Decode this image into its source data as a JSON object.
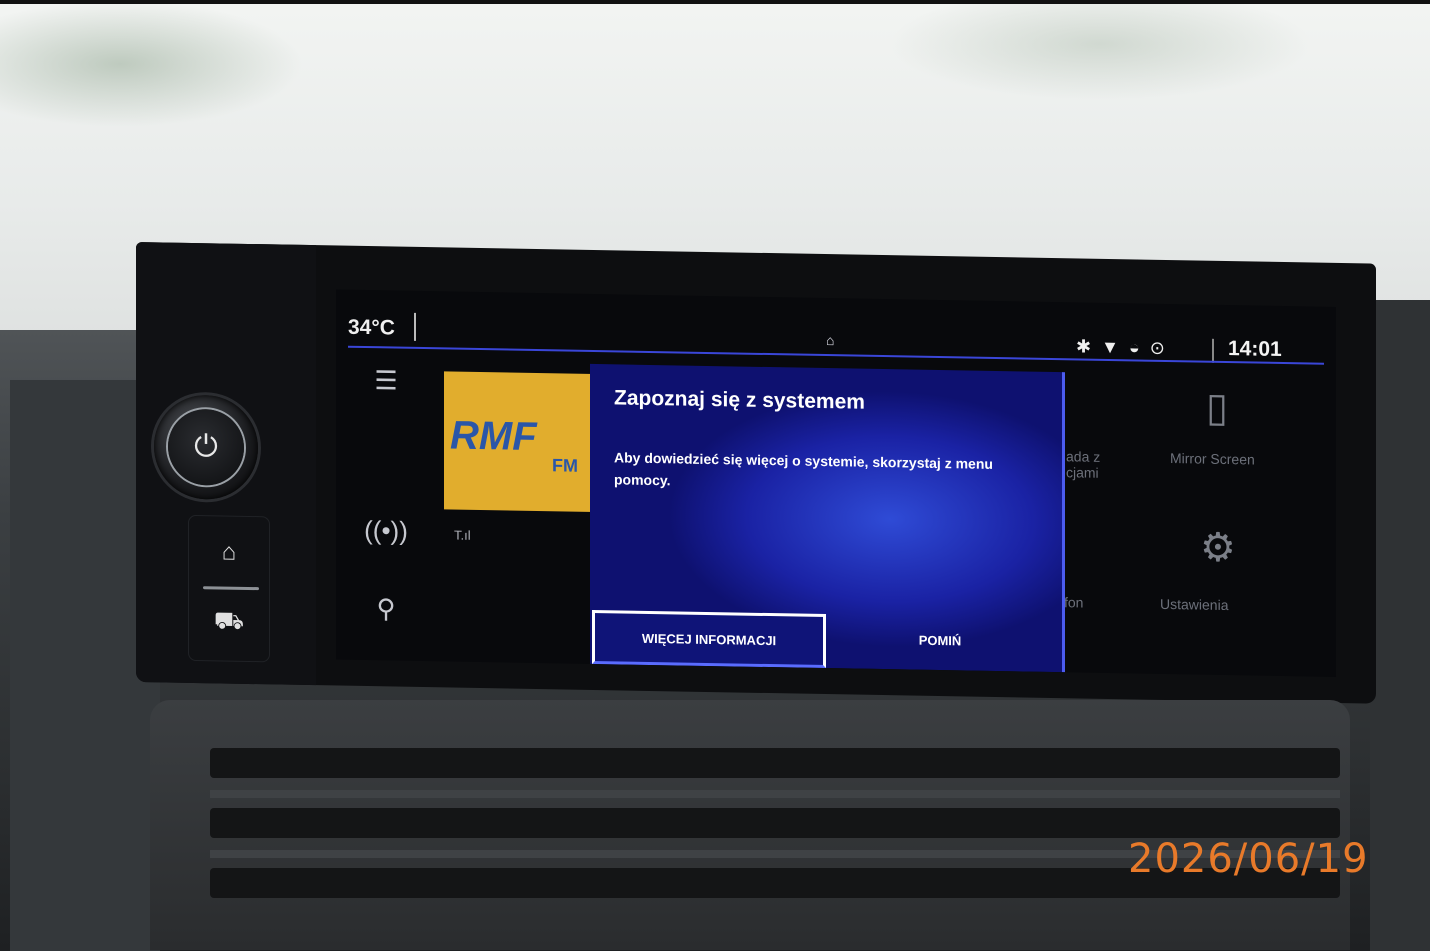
{
  "status_bar": {
    "temperature": "34°C",
    "time": "14:01",
    "icons": [
      "bluetooth-icon",
      "wifi-icon",
      "car-connect-icon",
      "location-icon"
    ]
  },
  "radio": {
    "station_logo_text": "RMF",
    "station_logo_sub": "FM",
    "signal": "T.ıl"
  },
  "background_tiles": {
    "mirror_screen_label": "Mirror Screen",
    "settings_label": "Ustawienia",
    "partial_label_1": "ada z\ncjami",
    "partial_label_2": "fon"
  },
  "dialog": {
    "title": "Zapoznaj się z systemem",
    "body": "Aby dowiedzieć się więcej o systemie, skorzystaj z menu pomocy.",
    "primary_button": "WIĘCEJ INFORMACJI",
    "secondary_button": "POMIŃ"
  },
  "photo_date": "2026/06/19",
  "colors": {
    "accent_blue": "#3a46d8",
    "dialog_blue": "#1a22a4",
    "radio_tile": "#e1ad2d",
    "date_orange": "#e87a2a"
  }
}
